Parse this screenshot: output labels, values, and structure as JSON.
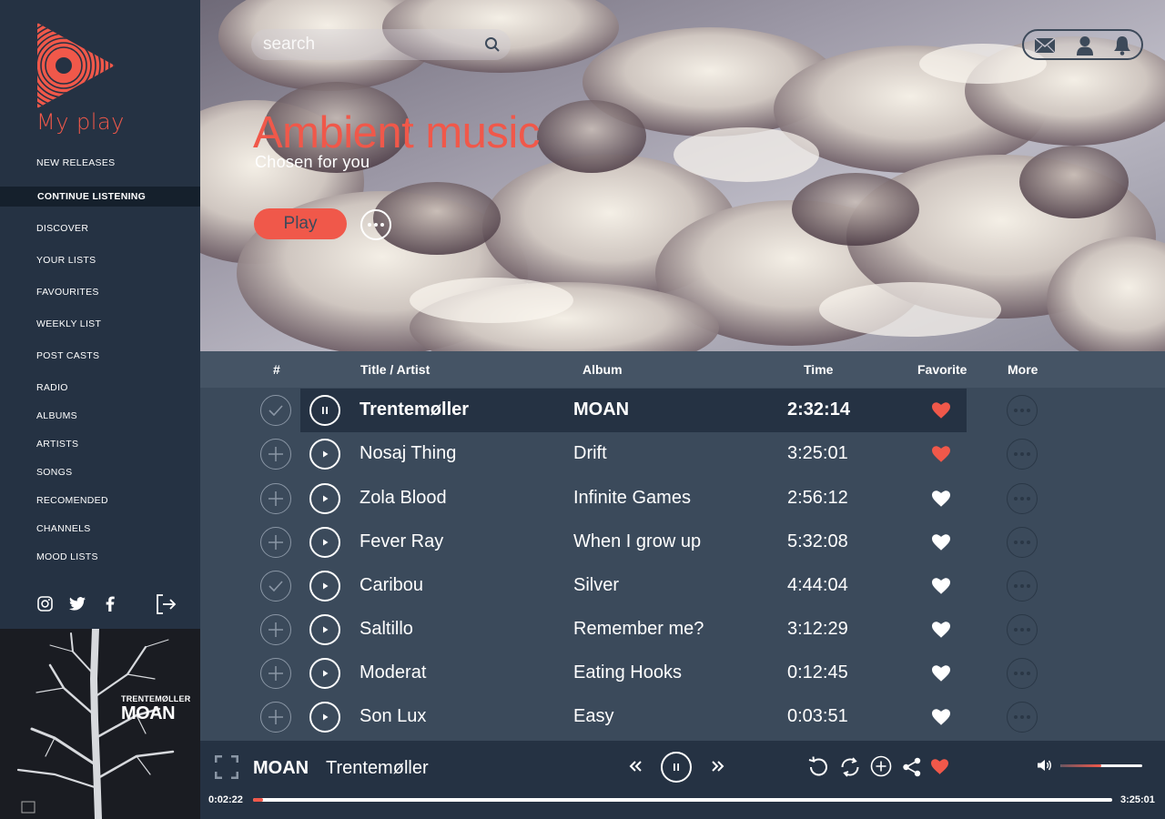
{
  "app": {
    "logo_text": "My play"
  },
  "sidebar": {
    "items": [
      {
        "label": "NEW RELEASES"
      },
      {
        "label": "CONTINUE LISTENING",
        "active": true
      },
      {
        "label": "DISCOVER"
      },
      {
        "label": "YOUR LISTS"
      },
      {
        "label": "FAVOURITES"
      },
      {
        "label": "WEEKLY LIST"
      },
      {
        "label": "POST CASTS"
      },
      {
        "label": "RADIO"
      },
      {
        "label": "ALBUMS"
      },
      {
        "label": "ARTISTS"
      },
      {
        "label": "SONGS"
      },
      {
        "label": "RECOMENDED"
      },
      {
        "label": "CHANNELS"
      },
      {
        "label": "MOOD LISTS"
      }
    ],
    "social": [
      "instagram-icon",
      "twitter-icon",
      "facebook-icon"
    ],
    "logout_icon": "logout-icon",
    "album_art": {
      "artist": "TRENTEMØLLER",
      "album": "MOAN"
    }
  },
  "header": {
    "search_placeholder": "search",
    "icons": [
      "mail-icon",
      "user-icon",
      "bell-icon"
    ]
  },
  "hero": {
    "title": "Ambient music",
    "subtitle": "Chosen for you",
    "play_label": "Play"
  },
  "table": {
    "columns": [
      "#",
      "Title / Artist",
      "Album",
      "Time",
      "Favorite",
      "More"
    ],
    "rows": [
      {
        "added": true,
        "playing": true,
        "artist": "Trentemøller",
        "album": "MOAN",
        "time": "2:32:14",
        "favorite": true
      },
      {
        "added": false,
        "playing": false,
        "artist": "Nosaj Thing",
        "album": "Drift",
        "time": "3:25:01",
        "favorite": true
      },
      {
        "added": false,
        "playing": false,
        "artist": "Zola Blood",
        "album": "Infinite Games",
        "time": "2:56:12",
        "favorite": false
      },
      {
        "added": false,
        "playing": false,
        "artist": "Fever Ray",
        "album": "When I grow up",
        "time": "5:32:08",
        "favorite": false
      },
      {
        "added": true,
        "playing": false,
        "artist": "Caribou",
        "album": "Silver",
        "time": "4:44:04",
        "favorite": false
      },
      {
        "added": false,
        "playing": false,
        "artist": "Saltillo",
        "album": "Remember me?",
        "time": "3:12:29",
        "favorite": false
      },
      {
        "added": false,
        "playing": false,
        "artist": "Moderat",
        "album": "Eating Hooks",
        "time": "0:12:45",
        "favorite": false
      },
      {
        "added": false,
        "playing": false,
        "artist": "Son Lux",
        "album": "Easy",
        "time": "0:03:51",
        "favorite": false
      }
    ]
  },
  "player": {
    "album": "MOAN",
    "artist": "Trentemøller",
    "elapsed": "0:02:22",
    "duration": "3:25:01",
    "progress": 0.012,
    "volume": 0.5,
    "favorite": true
  },
  "colors": {
    "accent": "#f0584a",
    "sidebar": "#253243",
    "main": "#3b4a5b",
    "header_row": "#455465"
  }
}
